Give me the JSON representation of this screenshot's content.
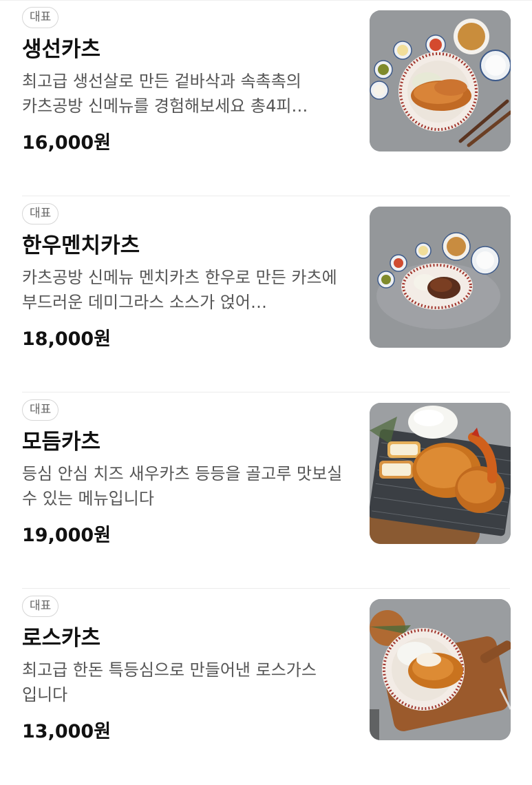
{
  "menu": {
    "items": [
      {
        "badge": "대표",
        "name": "생선카츠",
        "description": "최고급 생선살로 만든 겉바삭과 속촉촉의 카츠공방 신메뉴를 경험해보세요 총4피…",
        "price": "16,000원"
      },
      {
        "badge": "대표",
        "name": "한우멘치카츠",
        "description": "카츠공방 신메뉴 멘치카츠 한우로 만든 카츠에 부드러운 데미그라스 소스가 얹어…",
        "price": "18,000원"
      },
      {
        "badge": "대표",
        "name": "모듬카츠",
        "description": "등심 안심 치즈 새우카츠 등등을 골고루 맛보실 수 있는 메뉴입니다",
        "price": "19,000원"
      },
      {
        "badge": "대표",
        "name": "로스카츠",
        "description": "최고급 한돈 특등심으로 만들어낸 로스가스 입니다",
        "price": "13,000원"
      }
    ]
  }
}
